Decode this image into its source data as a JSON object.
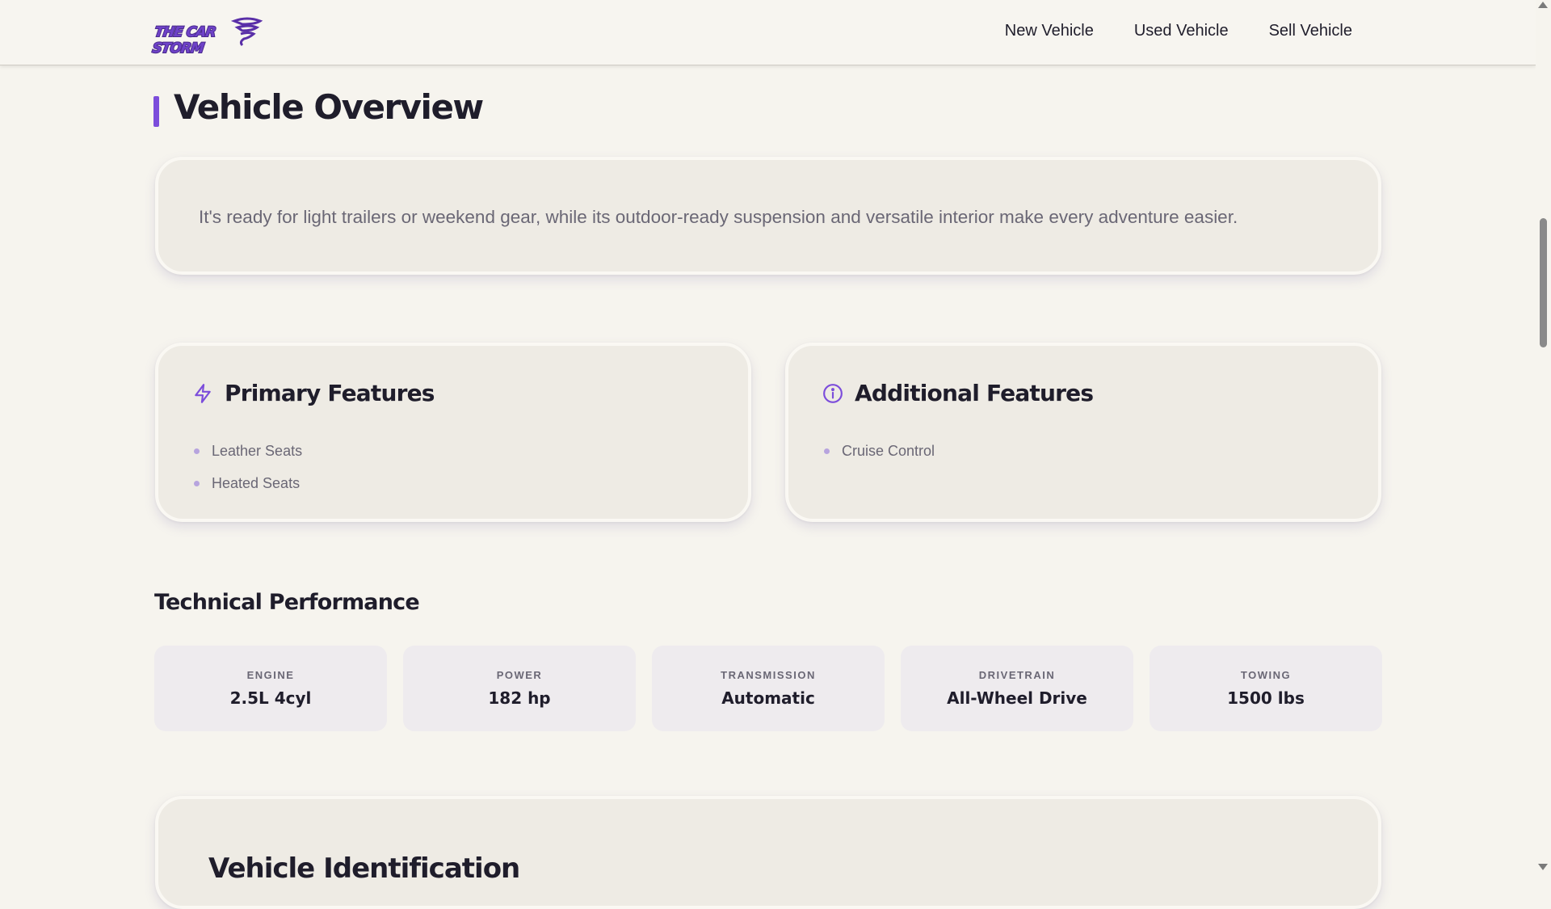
{
  "header": {
    "logo_text": "THE CAR STORM",
    "nav": [
      "New Vehicle",
      "Used Vehicle",
      "Sell Vehicle"
    ]
  },
  "overview": {
    "title": "Vehicle Overview",
    "description": "It's ready for light trailers or weekend gear, while its outdoor-ready suspension and versatile interior make every adventure easier."
  },
  "primary_features": {
    "title": "Primary Features",
    "icon": "lightning-icon",
    "items": [
      "Leather Seats",
      "Heated Seats"
    ]
  },
  "additional_features": {
    "title": "Additional Features",
    "icon": "info-icon",
    "items": [
      "Cruise Control"
    ]
  },
  "performance": {
    "title": "Technical Performance",
    "specs": [
      {
        "label": "ENGINE",
        "value": "2.5L 4cyl"
      },
      {
        "label": "POWER",
        "value": "182 hp"
      },
      {
        "label": "TRANSMISSION",
        "value": "Automatic"
      },
      {
        "label": "DRIVETRAIN",
        "value": "All-Wheel Drive"
      },
      {
        "label": "TOWING",
        "value": "1500 lbs"
      }
    ]
  },
  "identification": {
    "title": "Vehicle Identification"
  },
  "colors": {
    "accent": "#7c4ddb",
    "background": "#f6f4ee",
    "card": "#eeebe4"
  }
}
